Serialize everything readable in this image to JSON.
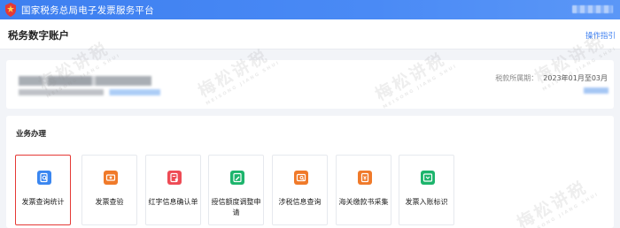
{
  "app": {
    "title": "国家税务总局电子发票服务平台",
    "emblem_caption": "税务"
  },
  "page": {
    "title": "税务数字账户",
    "guide_link": "操作指引"
  },
  "account": {
    "tax_period_label": "税款所属期：",
    "tax_period_value": "2023年01月至03月"
  },
  "business": {
    "title": "业务办理",
    "tiles": [
      {
        "label": "发票查询统计",
        "icon": "invoice-search-icon",
        "color": "#3a86f0",
        "selected": true
      },
      {
        "label": "发票查验",
        "icon": "ticket-verify-icon",
        "color": "#f07a2a",
        "selected": false
      },
      {
        "label": "红字信息确认单",
        "icon": "red-letter-doc-icon",
        "color": "#ee4b55",
        "selected": false
      },
      {
        "label": "授信额度调整申请",
        "icon": "credit-adjust-icon",
        "color": "#1db46c",
        "selected": false
      },
      {
        "label": "涉税信息查询",
        "icon": "tax-info-search-icon",
        "color": "#f07a2a",
        "selected": false
      },
      {
        "label": "海关缴款书采集",
        "icon": "customs-collect-icon",
        "color": "#f07a2a",
        "selected": false
      },
      {
        "label": "发票入账标识",
        "icon": "invoice-entry-icon",
        "color": "#1db46c",
        "selected": false
      }
    ]
  },
  "watermark": {
    "text": "梅松讲税",
    "subtext": "MEISONG JIANG SHUI"
  },
  "colors": {
    "brand_blue": "#3d7ff0",
    "selected_border": "#e53935"
  }
}
